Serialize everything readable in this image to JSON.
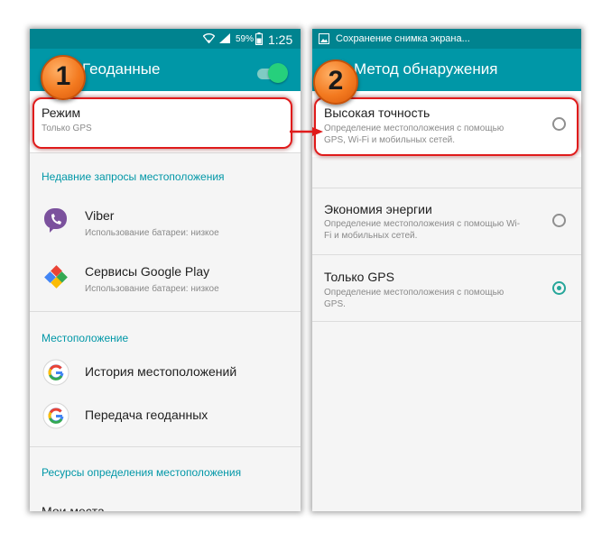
{
  "left": {
    "status": {
      "percent": "59%",
      "time": "1:25"
    },
    "appbar": {
      "title": "Геоданные",
      "badge": "1",
      "toggle_on": true
    },
    "mode": {
      "label": "Режим",
      "value": "Только GPS"
    },
    "recent_section": "Недавние запросы местоположения",
    "recent_apps": [
      {
        "name": "Viber",
        "detail": "Использование батареи: низкое",
        "icon": "viber-icon"
      },
      {
        "name": "Сервисы Google Play",
        "detail": "Использование батареи: низкое",
        "icon": "google-play-services-icon"
      }
    ],
    "location_section": "Местоположение",
    "location_items": [
      {
        "label": "История местоположений",
        "icon": "google-icon"
      },
      {
        "label": "Передача геоданных",
        "icon": "google-icon"
      }
    ],
    "sources_section": "Ресурсы определения местоположения",
    "partial_item": "Мои места"
  },
  "right": {
    "status": {
      "notification": "Сохранение снимка экрана..."
    },
    "appbar": {
      "title": "Метод обнаружения",
      "badge": "2"
    },
    "options": [
      {
        "label": "Высокая точность",
        "desc_line1": "Определение местоположения с помощью",
        "desc_line2": "GPS, Wi-Fi и мобильных сетей.",
        "selected": false
      },
      {
        "label": "Экономия энергии",
        "desc_line1": "Определение местоположения с помощью Wi-",
        "desc_line2": "Fi и мобильных сетей.",
        "selected": false
      },
      {
        "label": "Только GPS",
        "desc_line1": "Определение местоположения с помощью",
        "desc_line2": "GPS.",
        "selected": true
      }
    ]
  },
  "colors": {
    "statusbar": "#00838f",
    "appbar": "#0097a7",
    "accent": "#26a69a",
    "highlight_box": "#e01b1b",
    "badge": "#f37a20"
  }
}
